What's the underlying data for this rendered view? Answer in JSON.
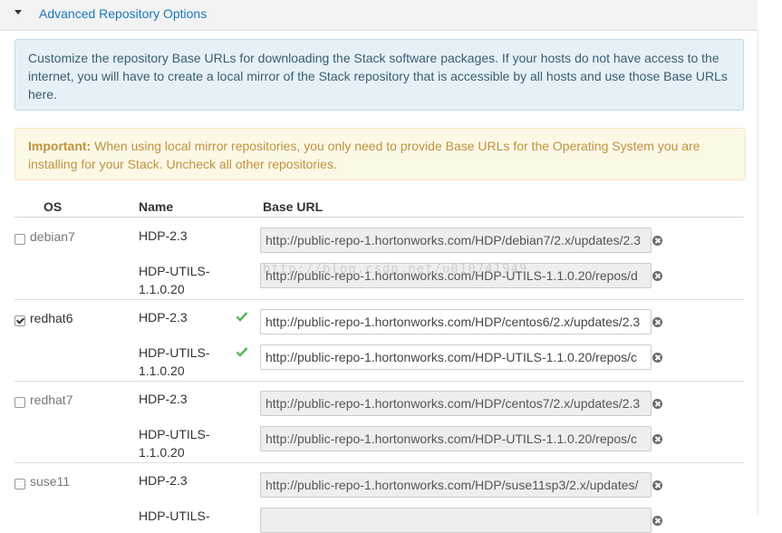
{
  "header": {
    "title": "Advanced Repository Options"
  },
  "info_alert": {
    "text": "Customize the repository Base URLs for downloading the Stack software packages. If your hosts do not have access to the internet, you will have to create a local mirror of the Stack repository that is accessible by all hosts and use those Base URLs here."
  },
  "warning_alert": {
    "label": "Important:",
    "text": " When using local mirror repositories, you only need to provide Base URLs for the Operating System you are installing for your Stack. Uncheck all other repositories."
  },
  "table": {
    "headers": {
      "os": "OS",
      "name": "Name",
      "base_url": "Base URL"
    }
  },
  "groups": [
    {
      "os": "debian7",
      "checked": false,
      "repos": [
        {
          "name": "HDP-2.3",
          "url": "http://public-repo-1.hortonworks.com/HDP/debian7/2.x/updates/2.3",
          "valid": false
        },
        {
          "name": "HDP-UTILS-1.1.0.20",
          "url": "http://public-repo-1.hortonworks.com/HDP-UTILS-1.1.0.20/repos/d",
          "valid": false
        }
      ]
    },
    {
      "os": "redhat6",
      "checked": true,
      "repos": [
        {
          "name": "HDP-2.3",
          "url": "http://public-repo-1.hortonworks.com/HDP/centos6/2.x/updates/2.3",
          "valid": true
        },
        {
          "name": "HDP-UTILS-1.1.0.20",
          "url": "http://public-repo-1.hortonworks.com/HDP-UTILS-1.1.0.20/repos/c",
          "valid": true
        }
      ]
    },
    {
      "os": "redhat7",
      "checked": false,
      "repos": [
        {
          "name": "HDP-2.3",
          "url": "http://public-repo-1.hortonworks.com/HDP/centos7/2.x/updates/2.3",
          "valid": false
        },
        {
          "name": "HDP-UTILS-1.1.0.20",
          "url": "http://public-repo-1.hortonworks.com/HDP-UTILS-1.1.0.20/repos/c",
          "valid": false
        }
      ]
    },
    {
      "os": "suse11",
      "checked": false,
      "repos": [
        {
          "name": "HDP-2.3",
          "url": "http://public-repo-1.hortonworks.com/HDP/suse11sp3/2.x/updates/",
          "valid": false
        },
        {
          "name": "HDP-UTILS-",
          "url": "",
          "valid": false
        }
      ]
    }
  ],
  "watermark": "http://blog.csdn.net/u010741949",
  "icons": {
    "caret": "caret-down-icon",
    "clear": "clear-circle-icon",
    "valid": "check-icon"
  },
  "colors": {
    "link": "#1a78b8",
    "valid_check": "#5cb85c",
    "info_bg": "#e5f1f7",
    "warning_bg": "#fcf8e6",
    "warning_text": "#c0923e"
  }
}
